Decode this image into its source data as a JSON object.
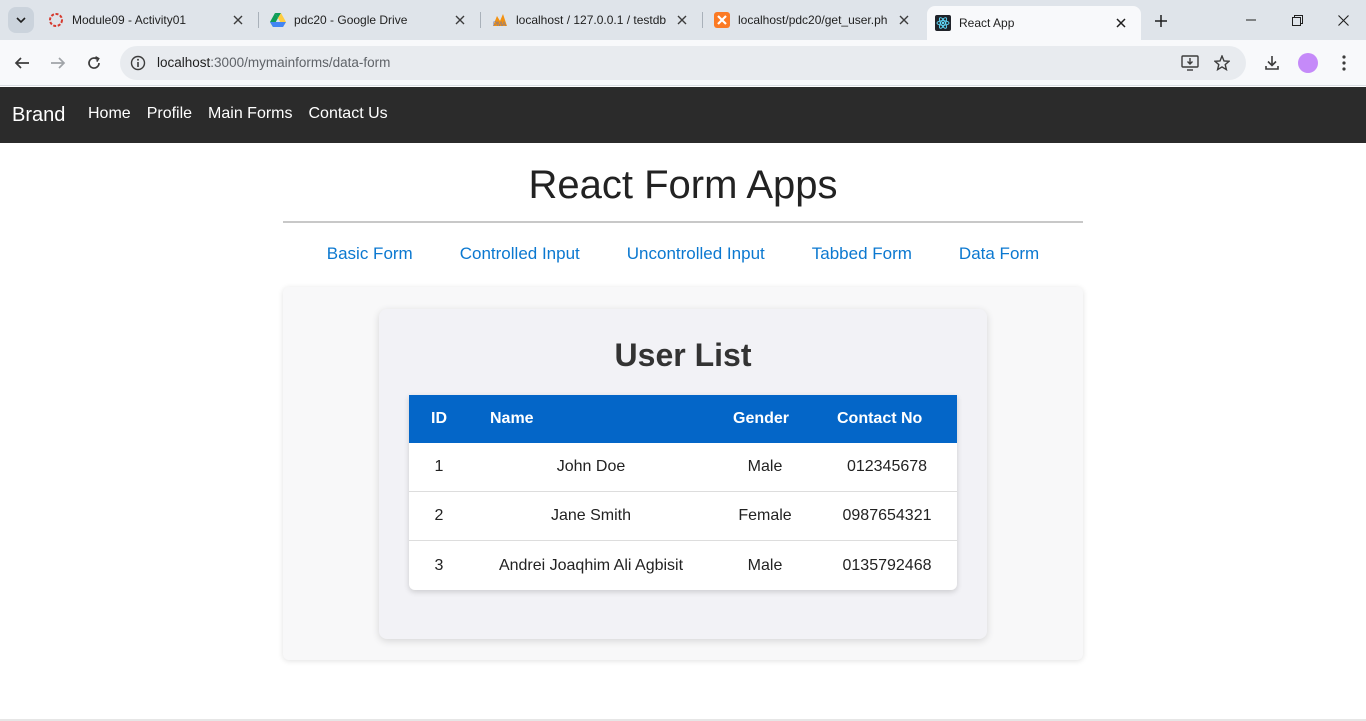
{
  "browser": {
    "tabs": [
      {
        "title": "Module09 - Activity01",
        "icon": "canvas-ring-icon"
      },
      {
        "title": "pdc20 - Google Drive",
        "icon": "google-drive-icon"
      },
      {
        "title": "localhost / 127.0.0.1 / testdb",
        "icon": "phpmyadmin-icon"
      },
      {
        "title": "localhost/pdc20/get_user.php",
        "icon": "xampp-icon"
      },
      {
        "title": "React App",
        "icon": "react-icon"
      }
    ],
    "url_host": "localhost",
    "url_path": ":3000/mymainforms/data-form"
  },
  "navbar": {
    "brand": "Brand",
    "links": [
      "Home",
      "Profile",
      "Main Forms",
      "Contact Us"
    ]
  },
  "page": {
    "title": "React Form Apps",
    "form_links": [
      "Basic Form",
      "Controlled Input",
      "Uncontrolled Input",
      "Tabbed Form",
      "Data Form"
    ]
  },
  "user_list": {
    "heading": "User List",
    "columns": [
      "ID",
      "Name",
      "Gender",
      "Contact No"
    ],
    "rows": [
      {
        "id": "1",
        "name": "John Doe",
        "gender": "Male",
        "contact": "012345678"
      },
      {
        "id": "2",
        "name": "Jane Smith",
        "gender": "Female",
        "contact": "0987654321"
      },
      {
        "id": "3",
        "name": "Andrei Joaqhim Ali Agbisit",
        "gender": "Male",
        "contact": "0135792468"
      }
    ]
  },
  "colors": {
    "navbar_bg": "#2b2b2b",
    "link": "#0b78d0",
    "table_header": "#0466c8"
  }
}
